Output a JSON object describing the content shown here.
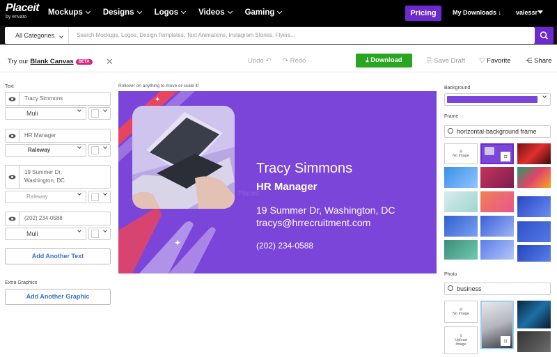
{
  "nav": {
    "logo_main": "Placeit",
    "logo_sub": "by envato",
    "menu": [
      {
        "label": "Mockups"
      },
      {
        "label": "Designs"
      },
      {
        "label": "Logos"
      },
      {
        "label": "Videos"
      },
      {
        "label": "Gaming"
      }
    ],
    "pricing_label": "Pricing",
    "downloads_label": "My Downloads",
    "user_label": "valessr"
  },
  "search": {
    "category": "All Categories",
    "placeholder": "Search Mockups, Logos, Design Templates, Text Animations, Instagram Stories, Flyers..."
  },
  "toolbar": {
    "try_prefix": "Try our",
    "blank_canvas": "Blank Canvas",
    "beta": "BETA",
    "undo": "Undo",
    "redo": "Redo",
    "download": "Download",
    "save_draft": "Save Draft",
    "favorite": "Favorite",
    "share": "Share"
  },
  "left": {
    "text_label": "Text",
    "fields": [
      {
        "value": "Tracy Simmons",
        "font": "Muli"
      },
      {
        "value": "HR Manager",
        "font": "Raleway"
      },
      {
        "value_line1": "19 Summer Dr,",
        "value_line2": "Washington, DC",
        "font": "Raleway"
      },
      {
        "value": "(202) 234-0588",
        "font": "Muli"
      }
    ],
    "add_text": "Add Another Text",
    "extra_label": "Extra Graphics",
    "add_graphic": "Add Another Graphic"
  },
  "canvas": {
    "hint": "Rollover on anything to move or scale it!",
    "name": "Tracy Simmons",
    "title": "HR Manager",
    "address": "19 Summer Dr, Washington, DC",
    "email": "tracys@hrrecruitment.com",
    "phone": "(202) 234-0588",
    "watermark": "Placeit"
  },
  "right": {
    "background_label": "Background",
    "background_color": "#7b45d9",
    "frame_label": "Frame",
    "frame_search": "horizontal-background frame",
    "no_image": "No Image",
    "photo_label": "Photo",
    "photo_search": "business",
    "upload_image_line1": "Upload",
    "upload_image_line2": "Image"
  },
  "colors": {
    "accent": "#6c29cf",
    "download_green": "#29a621",
    "link_blue": "#3a72c9",
    "beta_pink": "#d9237f"
  }
}
